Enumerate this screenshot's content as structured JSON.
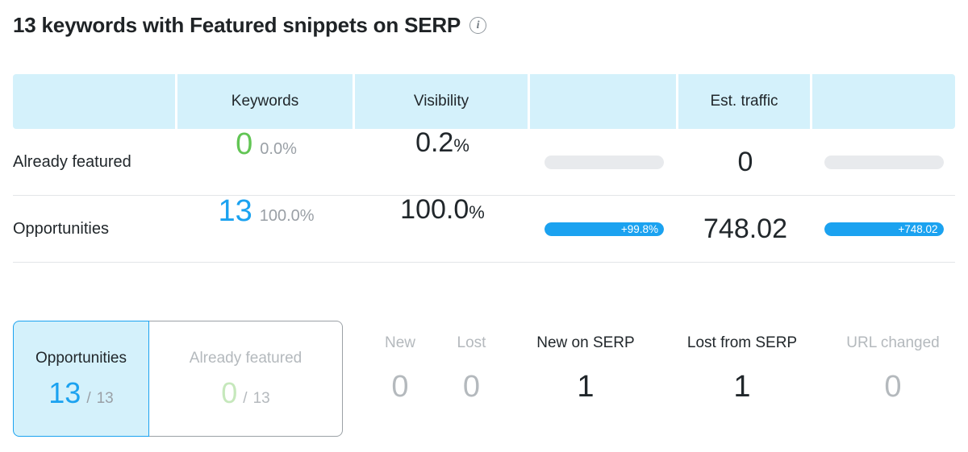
{
  "header": {
    "title": "13 keywords with Featured snippets on SERP",
    "info_icon": "info-icon",
    "info_glyph": "i"
  },
  "table": {
    "columns": [
      "",
      "Keywords",
      "Visibility",
      "",
      "Est. traffic",
      ""
    ],
    "rows": [
      {
        "label": "Already featured",
        "keywords_count": "0",
        "keywords_pct": "0.0%",
        "keywords_color": "#62c554",
        "visibility_value": "0.2",
        "visibility_unit": "%",
        "visibility_bar_pct": 0,
        "visibility_bar_label": "",
        "traffic_value": "0",
        "traffic_bar_pct": 0,
        "traffic_bar_label": ""
      },
      {
        "label": "Opportunities",
        "keywords_count": "13",
        "keywords_pct": "100.0%",
        "keywords_color": "#1ba2f0",
        "visibility_value": "100.0",
        "visibility_unit": "%",
        "visibility_bar_pct": 100,
        "visibility_bar_label": "+99.8%",
        "traffic_value": "748.02",
        "traffic_bar_pct": 100,
        "traffic_bar_label": "+748.02"
      }
    ]
  },
  "tabs": [
    {
      "label": "Opportunities",
      "value": "13",
      "separator": "/",
      "total": "13",
      "selected": true,
      "accent": "#1ba2f0"
    },
    {
      "label": "Already featured",
      "value": "0",
      "separator": "/",
      "total": "13",
      "selected": false,
      "accent": "#c6e8bc"
    }
  ],
  "stats": [
    {
      "label": "New",
      "value": "0",
      "active": false
    },
    {
      "label": "Lost",
      "value": "0",
      "active": false
    },
    {
      "label": "New on SERP",
      "value": "1",
      "active": true
    },
    {
      "label": "Lost from SERP",
      "value": "1",
      "active": true
    },
    {
      "label": "URL changed",
      "value": "0",
      "active": false
    }
  ],
  "colors": {
    "accent_blue": "#1ba2f0",
    "header_bg": "#d4f1fb",
    "green": "#62c554",
    "muted": "#9aa0a6",
    "bar_track": "#e8eaed"
  }
}
